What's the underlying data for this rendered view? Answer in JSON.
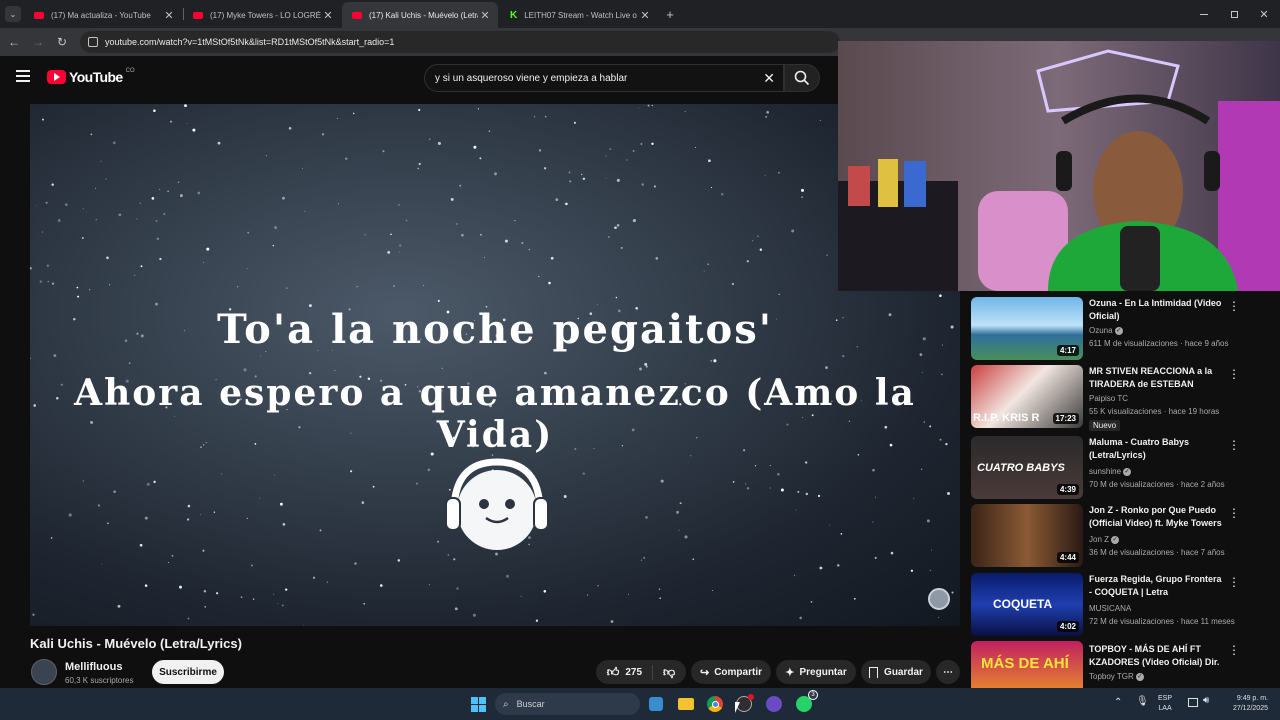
{
  "tabs": [
    {
      "title": "(17) Ma actualiza - YouTube",
      "favicon": "youtube-icon"
    },
    {
      "title": "(17) Myke Towers - LO LOGRÉ (",
      "favicon": "youtube-icon"
    },
    {
      "title": "(17) Kali Uchis - Muévelo (Letra",
      "favicon": "youtube-icon",
      "active": true
    },
    {
      "title": "LEITH07 Stream - Watch Live o",
      "favicon": "kick-icon"
    }
  ],
  "address_bar": {
    "url": "youtube.com/watch?v=1tMStOf5tNk&list=RD1tMStOf5tNk&start_radio=1"
  },
  "youtube": {
    "logo_text": "YouTube",
    "country_code": "CO",
    "search_query": "y si un asqueroso viene y empieza a hablar"
  },
  "video": {
    "lyric_line_1": "To'a la noche pegaitos'",
    "lyric_line_2": "Ahora espero a que amanezco (Amo la Vida)",
    "title": "Kali Uchis - Muévelo (Letra/Lyrics)"
  },
  "channel": {
    "name": "Mellifluous",
    "subscribers": "60,3 K suscriptores",
    "subscribe_label": "Suscribirme"
  },
  "actions": {
    "likes": "275",
    "share_label": "Compartir",
    "ask_label": "Preguntar",
    "save_label": "Guardar"
  },
  "recommendations": [
    {
      "title": "Ozuna - En La Intimidad (Video Oficial)",
      "channel": "Ozuna",
      "verified": true,
      "meta": "611 M de visualizaciones · hace 9 años",
      "duration": "4:17",
      "badge": ""
    },
    {
      "title": "MR STIVEN REACCIONA a la TIRADERA de ESTEBAN ROJA...",
      "channel": "Paipiso TC",
      "verified": false,
      "meta": "55 K visualizaciones · hace 19 horas",
      "duration": "17:23",
      "badge": "Nuevo",
      "thumb_text": "R.I.P. KRIS R"
    },
    {
      "title": "Maluma - Cuatro Babys (Letra/Lyrics)",
      "channel": "sunshine",
      "verified": true,
      "meta": "70 M de visualizaciones · hace 2 años",
      "duration": "4:39",
      "badge": "",
      "thumb_text": "CUATRO BABYS"
    },
    {
      "title": "Jon Z - Ronko por Que Puedo (Official Video) ft. Myke Towers",
      "channel": "Jon Z",
      "verified": true,
      "meta": "36 M de visualizaciones · hace 7 años",
      "duration": "4:44",
      "badge": ""
    },
    {
      "title": "Fuerza Regida, Grupo Frontera - COQUETA | Letra",
      "channel": "MUSICANA",
      "verified": false,
      "meta": "72 M de visualizaciones · hace 11 meses",
      "duration": "4:02",
      "badge": "",
      "thumb_text": "COQUETA"
    },
    {
      "title": "TOPBOY - MÁS DE AHÍ FT KZADORES (Video Oficial) Dir. ...",
      "channel": "Topboy TGR",
      "verified": true,
      "meta": "",
      "duration": "",
      "badge": "",
      "thumb_text": "MÁS DE AHÍ"
    }
  ],
  "taskbar": {
    "search_placeholder": "Buscar",
    "lang_1": "ESP",
    "lang_2": "LAA",
    "time": "9:49 p. m.",
    "date": "27/12/2025",
    "whatsapp_badge": "3"
  },
  "colors": {
    "youtube_red": "#ff0033",
    "kick_green": "#53fc18",
    "background": "#0f0f0f",
    "taskbar": "#1f2a38"
  }
}
